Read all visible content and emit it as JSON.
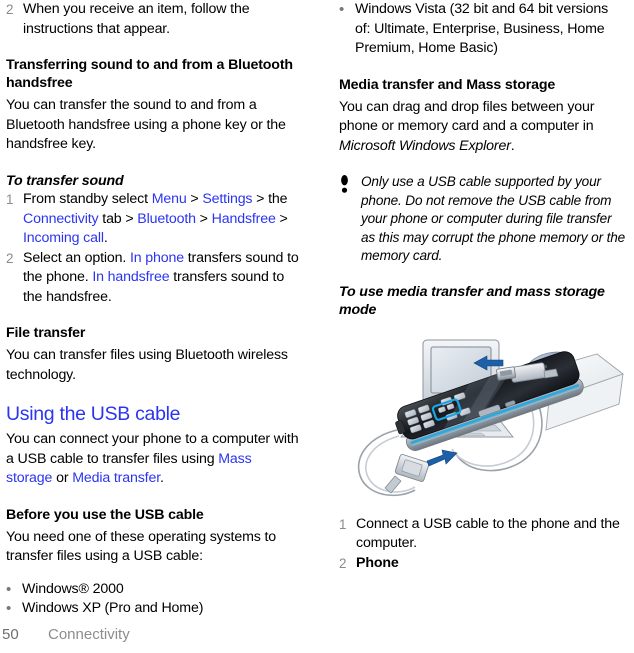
{
  "document": {
    "footer": {
      "page_number": "50",
      "chapter": "Connectivity"
    }
  },
  "left_column": {
    "step_continued": {
      "number": "2",
      "text": "When you receive an item, follow the instructions that appear."
    },
    "section_transferring_sound": {
      "heading": "Transferring sound to and from a Bluetooth handsfree",
      "body": "You can transfer the sound to and from a Bluetooth handsfree using a phone key or the handsfree key."
    },
    "procedure_transfer_sound": {
      "heading": "To transfer sound",
      "steps": [
        {
          "number": "1",
          "parts": [
            {
              "text": "From standby select ",
              "style": "plain"
            },
            {
              "text": "Menu",
              "style": "link"
            },
            {
              "text": " > ",
              "style": "plain"
            },
            {
              "text": "Settings",
              "style": "link"
            },
            {
              "text": " > the ",
              "style": "plain"
            },
            {
              "text": "Connectivity",
              "style": "link"
            },
            {
              "text": " tab > ",
              "style": "plain"
            },
            {
              "text": "Bluetooth",
              "style": "link"
            },
            {
              "text": " > ",
              "style": "plain"
            },
            {
              "text": "Handsfree",
              "style": "link"
            },
            {
              "text": " > ",
              "style": "plain"
            },
            {
              "text": "Incoming call",
              "style": "link"
            },
            {
              "text": ".",
              "style": "plain"
            }
          ]
        },
        {
          "number": "2",
          "parts": [
            {
              "text": "Select an option. ",
              "style": "plain"
            },
            {
              "text": "In phone",
              "style": "link"
            },
            {
              "text": " transfers sound to the phone. ",
              "style": "plain"
            },
            {
              "text": "In handsfree",
              "style": "link"
            },
            {
              "text": " transfers sound to the handsfree.",
              "style": "plain"
            }
          ]
        }
      ]
    },
    "section_file_transfer": {
      "heading": "File transfer",
      "body": "You can transfer files using Bluetooth wireless technology."
    },
    "section_usb_cable": {
      "heading": "Using the USB cable",
      "body_parts": [
        {
          "text": "You can connect your phone to a computer with a USB cable to transfer files using ",
          "style": "plain"
        },
        {
          "text": "Mass storage",
          "style": "link"
        },
        {
          "text": " or ",
          "style": "plain"
        },
        {
          "text": "Media transfer",
          "style": "link"
        },
        {
          "text": ".",
          "style": "plain"
        }
      ]
    },
    "section_before_usb": {
      "heading": "Before you use the USB cable",
      "body": "You need one of these operating systems to transfer files using a USB cable:",
      "bullets": [
        "Windows® 2000",
        "Windows XP (Pro and Home)"
      ]
    }
  },
  "right_column": {
    "bullets_continued": [
      "Windows Vista (32 bit and 64 bit versions of: Ultimate, Enterprise, Business, Home Premium, Home Basic)"
    ],
    "section_media_transfer": {
      "heading": "Media transfer and Mass storage",
      "body_parts": [
        {
          "text": "You can drag and drop files between your phone or memory card and a computer in ",
          "style": "plain"
        },
        {
          "text": "Microsoft Windows Explorer",
          "style": "italic"
        },
        {
          "text": ".",
          "style": "plain"
        }
      ]
    },
    "note": {
      "icon": "exclamation-warning-icon",
      "text": "Only use a USB cable supported by your phone. Do not remove the USB cable from your phone or computer during file transfer as this may corrupt the phone memory or the memory card."
    },
    "procedure_media_transfer": {
      "heading": "To use media transfer and mass storage mode",
      "illustration_alt": "phone-usb-computer-illustration",
      "steps": [
        {
          "number": "1",
          "text": "Connect a USB cable to the phone and the computer.",
          "bold": false
        },
        {
          "number": "2",
          "text": "Phone",
          "bold": true
        }
      ]
    }
  },
  "colors": {
    "link": "#2b35f0",
    "heading_blue": "#2b35f0",
    "step_number_gray": "#8b8b8b",
    "bullet_gray": "#777777",
    "footer_gray": "#8d8d8d"
  }
}
